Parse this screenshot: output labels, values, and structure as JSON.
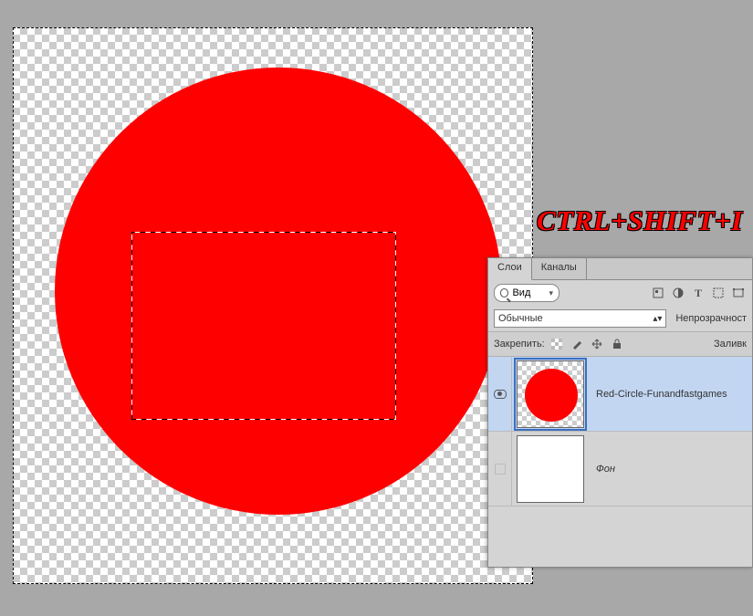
{
  "annotation": "CTRL+SHIFT+I",
  "panel": {
    "tabs": {
      "layers": "Слои",
      "channels": "Каналы"
    },
    "filter_label": "Вид",
    "blend_mode": "Обычные",
    "opacity_label": "Непрозрачност",
    "lock_label": "Закрепить:",
    "fill_label": "Заливк"
  },
  "layers": [
    {
      "name": "Red-Circle-Funandfastgames",
      "visible": true,
      "selected": true,
      "hasCircle": true
    },
    {
      "name": "Фон",
      "visible": false,
      "selected": false,
      "hasCircle": false
    }
  ]
}
